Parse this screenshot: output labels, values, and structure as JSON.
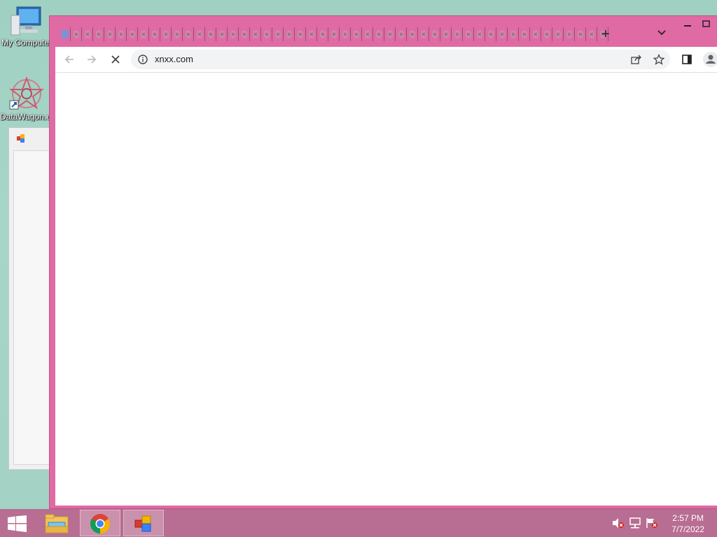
{
  "desktop": {
    "icons": [
      {
        "label": "My Computer",
        "icon": "computer-icon"
      },
      {
        "label": "DataWagon.exe",
        "icon": "datawagon-icon"
      }
    ]
  },
  "browser": {
    "address": {
      "url": "xnxx.com"
    },
    "new_tab_label": "+",
    "colors": {
      "frame": "#e06aa4",
      "taskbar": "#b86d92"
    }
  },
  "taskbar": {
    "items": [
      {
        "name": "start",
        "icon": "windows-logo-icon"
      },
      {
        "name": "file-explorer",
        "icon": "folder-icon"
      },
      {
        "name": "chrome",
        "icon": "chrome-icon"
      },
      {
        "name": "app",
        "icon": "app-window-icon"
      }
    ],
    "clock": {
      "time": "2:57 PM",
      "date": "7/7/2022"
    }
  }
}
